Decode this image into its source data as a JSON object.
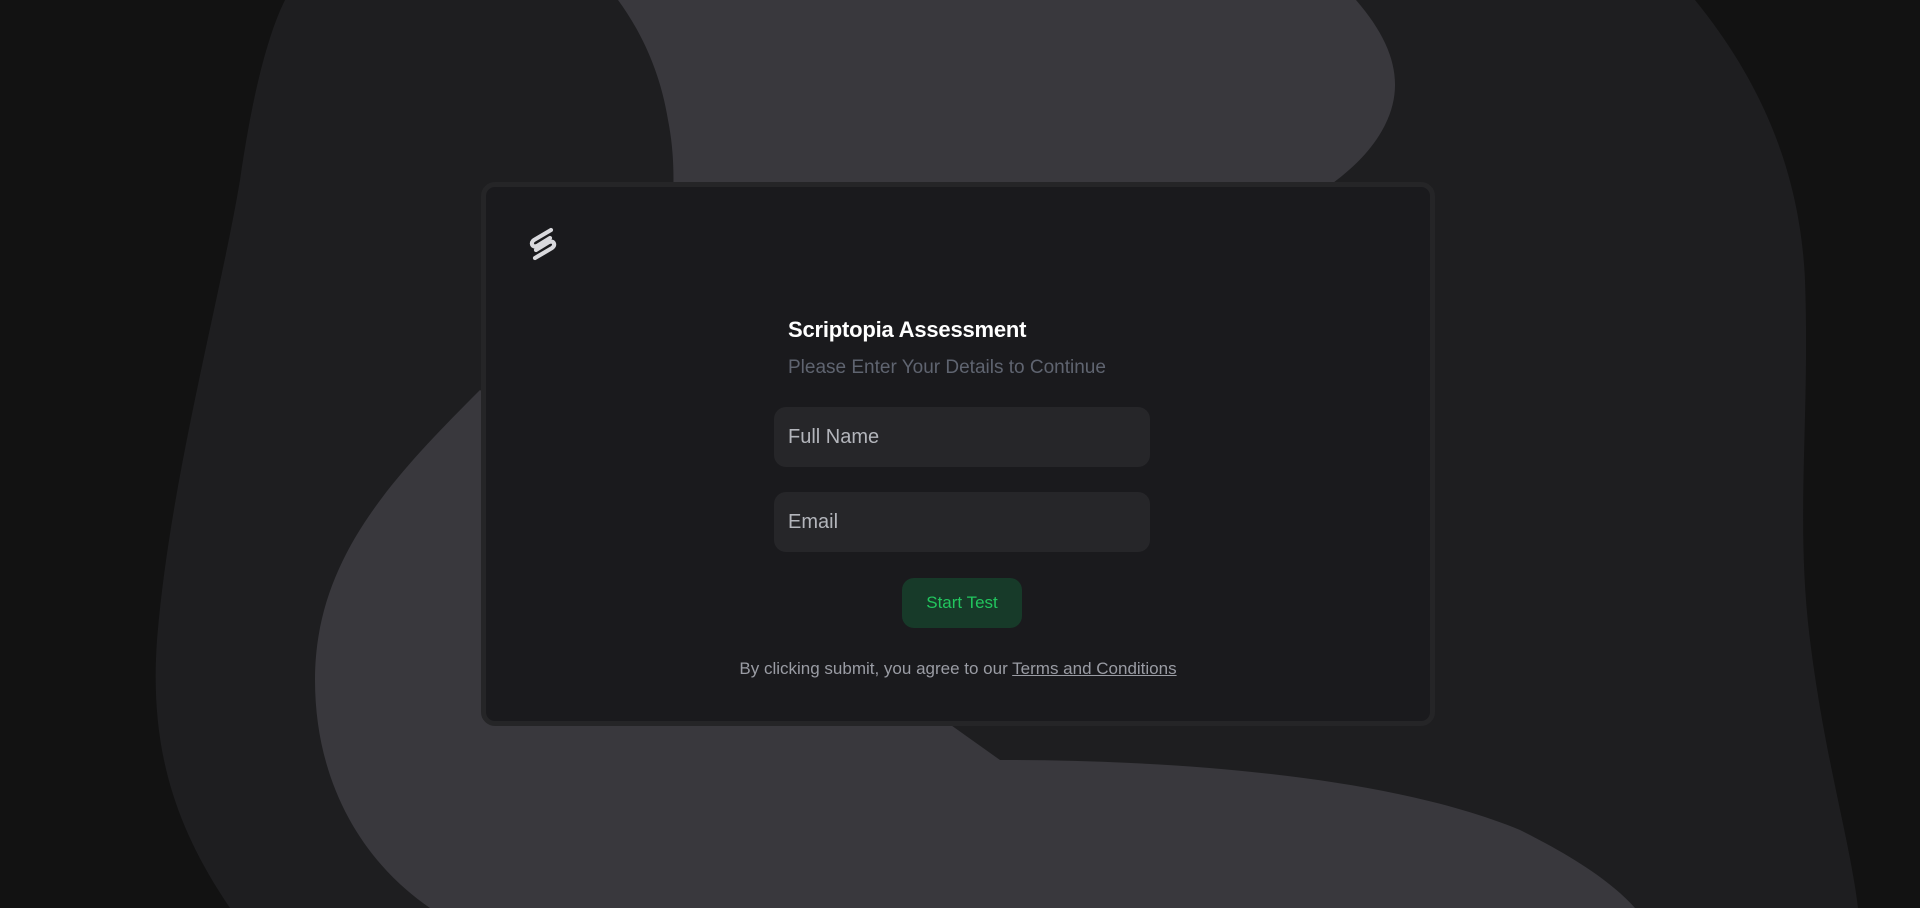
{
  "colors": {
    "page_background": "#121212",
    "blob_dark": "#1e1e20",
    "blob_light": "#39383d",
    "card_background": "#1a1a1d",
    "card_border": "#252527",
    "input_background": "#262629",
    "button_background": "#173a29",
    "button_text": "#22c55e",
    "subtitle_text": "#5f6470"
  },
  "logo": {
    "icon": "paperclip-s-logo-icon"
  },
  "form": {
    "title": "Scriptopia Assessment",
    "subtitle": "Please Enter Your Details to Continue",
    "full_name_placeholder": "Full Name",
    "full_name_value": "",
    "email_placeholder": "Email",
    "email_value": "",
    "submit_label": "Start Test"
  },
  "terms": {
    "prefix": "By clicking submit, you agree to our",
    "link_label": "Terms and Conditions"
  }
}
